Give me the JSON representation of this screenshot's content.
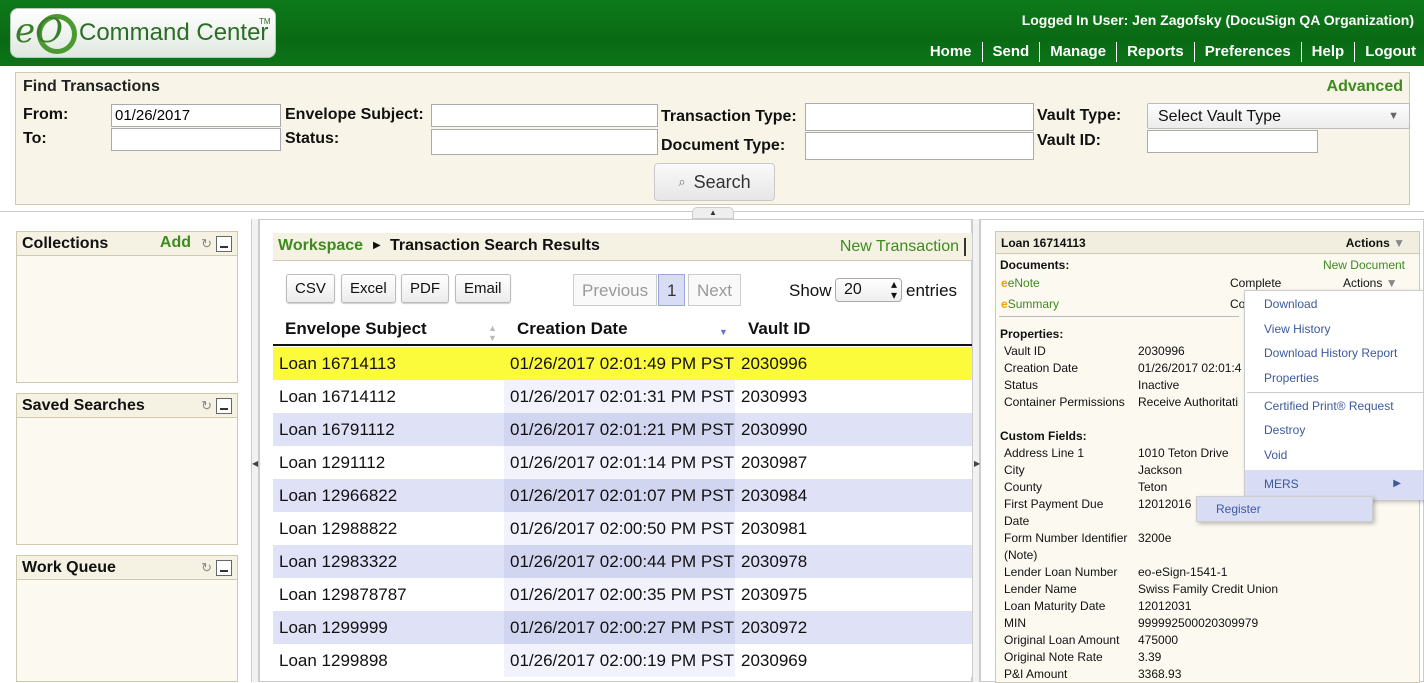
{
  "header": {
    "logo_mark": "eO",
    "logo_text": "Command Center",
    "logo_tm": "TM",
    "logged_in": "Logged In User: Jen Zagofsky (DocuSign QA Organization)",
    "nav": [
      "Home",
      "Send",
      "Manage",
      "Reports",
      "Preferences",
      "Help",
      "Logout"
    ]
  },
  "find": {
    "title": "Find Transactions",
    "advanced": "Advanced",
    "from_label": "From:",
    "from_value": "01/26/2017",
    "to_label": "To:",
    "to_value": "",
    "subject_label": "Envelope Subject:",
    "subject_value": "",
    "status_label": "Status:",
    "status_value": "",
    "txn_type_label": "Transaction Type:",
    "txn_type_value": "",
    "doc_type_label": "Document Type:",
    "doc_type_value": "",
    "vault_type_label": "Vault Type:",
    "vault_type_value": "Select Vault Type",
    "vault_id_label": "Vault ID:",
    "vault_id_value": "",
    "search_label": "Search"
  },
  "sidebar": {
    "collections": {
      "title": "Collections",
      "add": "Add"
    },
    "saved_searches": {
      "title": "Saved Searches"
    },
    "work_queue": {
      "title": "Work Queue"
    }
  },
  "results": {
    "breadcrumb_root": "Workspace",
    "breadcrumb_title": "Transaction Search Results",
    "new_transaction": "New Transaction",
    "export_buttons": [
      "CSV",
      "Excel",
      "PDF",
      "Email"
    ],
    "pager": {
      "previous": "Previous",
      "current": "1",
      "next": "Next"
    },
    "show_label": "Show",
    "show_value": "20",
    "entries_label": "entries",
    "columns": [
      "Envelope Subject",
      "Creation Date",
      "Vault ID"
    ],
    "rows": [
      [
        "Loan 16714113",
        "01/26/2017 02:01:49 PM PST",
        "2030996"
      ],
      [
        "Loan 16714112",
        "01/26/2017 02:01:31 PM PST",
        "2030993"
      ],
      [
        "Loan 16791112",
        "01/26/2017 02:01:21 PM PST",
        "2030990"
      ],
      [
        "Loan 1291112",
        "01/26/2017 02:01:14 PM PST",
        "2030987"
      ],
      [
        "Loan 12966822",
        "01/26/2017 02:01:07 PM PST",
        "2030984"
      ],
      [
        "Loan 12988822",
        "01/26/2017 02:00:50 PM PST",
        "2030981"
      ],
      [
        "Loan 12983322",
        "01/26/2017 02:00:44 PM PST",
        "2030978"
      ],
      [
        "Loan 129878787",
        "01/26/2017 02:00:35 PM PST",
        "2030975"
      ],
      [
        "Loan 1299999",
        "01/26/2017 02:00:27 PM PST",
        "2030972"
      ],
      [
        "Loan 1299898",
        "01/26/2017 02:00:19 PM PST",
        "2030969"
      ]
    ],
    "selected_row": 0,
    "highlight_color": "#fbfb3c"
  },
  "detail": {
    "title": "Loan 16714113",
    "actions": "Actions",
    "documents_label": "Documents:",
    "new_document": "New Document",
    "doc1_name": "eNote",
    "doc1_status": "Complete",
    "doc1_actions": "Actions",
    "doc2_name": "Summary",
    "doc2_status_partial": "Co",
    "properties_label": "Properties:",
    "properties": [
      [
        "Vault ID",
        "2030996"
      ],
      [
        "Creation Date",
        "01/26/2017 02:01:4"
      ],
      [
        "Status",
        "Inactive"
      ],
      [
        "Container Permissions",
        "Receive Authoritati"
      ]
    ],
    "custom_fields_label": "Custom Fields:",
    "custom_fields": [
      [
        "Address Line 1",
        "1010 Teton Drive"
      ],
      [
        "City",
        "Jackson"
      ],
      [
        "County",
        "Teton"
      ],
      [
        "First Payment Due",
        "12012016"
      ],
      [
        "Date",
        ""
      ],
      [
        "Form Number Identifier",
        "3200e"
      ],
      [
        "(Note)",
        ""
      ],
      [
        "Lender Loan Number",
        "eo-eSign-1541-1"
      ],
      [
        "Lender Name",
        "Swiss Family Credit Union"
      ],
      [
        "Loan Maturity Date",
        "12012031"
      ],
      [
        "MIN",
        "999992500020309979"
      ],
      [
        "Original Loan Amount",
        "475000"
      ],
      [
        "Original Note Rate",
        "3.39"
      ],
      [
        "P&I Amount",
        "3368.93"
      ]
    ]
  },
  "context_menu": {
    "items": [
      "Download",
      "View History",
      "Download History Report",
      "Properties",
      "Certified Print® Request",
      "Destroy",
      "Void",
      "MERS"
    ],
    "submenu": [
      "Register"
    ]
  },
  "colors": {
    "brand_green": "#0a6a14",
    "link_green": "#3d8b1f",
    "stripe": "#dfe1f7"
  }
}
